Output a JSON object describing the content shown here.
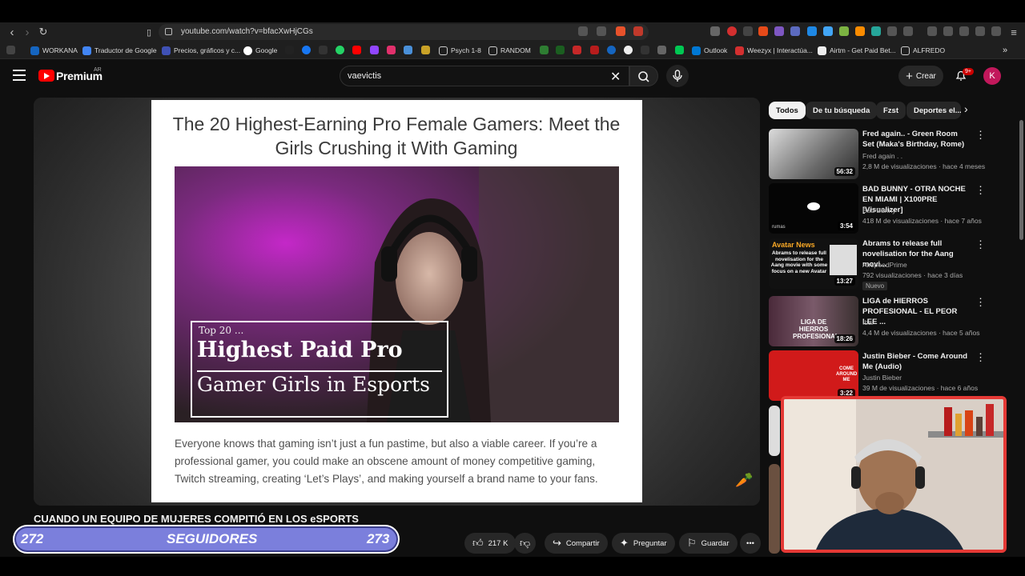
{
  "browser": {
    "url": "youtube.com/watch?v=bfacXwHjCGs",
    "bookmarks": [
      "WORKANA",
      "Traductor de Google",
      "Precios, gráficos y c...",
      "Google",
      "Psych 1-8",
      "RANDOM",
      "Outlook",
      "Weezyx | Interactúa...",
      "Airtm - Get Paid Bet...",
      "ALFREDO"
    ]
  },
  "header": {
    "logo_text": "Premium",
    "logo_region": "AR",
    "search_value": "vaevictis",
    "create_label": "Crear",
    "notification_count": "9+",
    "avatar_letter": "K"
  },
  "video": {
    "article_title": "The 20 Highest-Earning Pro Female Gamers: Meet the Girls Crushing it With Gaming",
    "overlay_top": "Top 20 ...",
    "overlay_main": "Highest Paid Pro",
    "overlay_sub": "Gamer Girls in Esports",
    "article_body": "Everyone knows that gaming isn’t just a fun pastime, but also a viable career. If you’re a professional gamer, you could make an obscene amount of money competitive gaming, Twitch streaming, creating ‘Let’s Plays’, and making yourself a brand name to your fans.",
    "title": "CUANDO UN EQUIPO DE MUJERES COMPITIÓ EN LOS eSPORTS",
    "likes": "217 K",
    "share_label": "Compartir",
    "ask_label": "Preguntar",
    "save_label": "Guardar"
  },
  "follower_overlay": {
    "left": "272",
    "label": "SEGUIDORES",
    "right": "273"
  },
  "chips": [
    "Todos",
    "De tu búsqueda",
    "Fzst",
    "Deportes el..."
  ],
  "recommendations": [
    {
      "title": "Fred again.. - Green Room Set (Maka's Birthday, Rome)",
      "channel": "Fred again . .",
      "meta": "2,8 M de visualizaciones · hace 4 meses",
      "duration": "56:32"
    },
    {
      "title": "BAD BUNNY - OTRA NOCHE EN MIAMI | X100PRE [Visualizer]",
      "channel": "Bad Bunny",
      "meta": "418 M de visualizaciones · hace 7 años",
      "duration": "3:54",
      "thumb_text": "rumas"
    },
    {
      "title": "Abrams to release full novelisation for the Aang movi...",
      "channel": "AirspeedPrime",
      "meta": "792 visualizaciones · hace 3 días",
      "duration": "13:27",
      "badge": "Nuevo",
      "thumb_title": "Avatar News",
      "thumb_text": "Abrams to release full novelisation for the Aang movie with some focus on a new Avatar"
    },
    {
      "title": "LIGA de HIERROS PROFESIONAL - EL PEOR LEE ...",
      "channel": "Ibai",
      "meta": "4,4 M de visualizaciones · hace 5 años",
      "duration": "18:26",
      "thumb_text": "LIGA DE HIERROS PROFESIONAL"
    },
    {
      "title": "Justin Bieber - Come Around Me (Audio)",
      "channel": "Justin Bieber",
      "meta": "39 M de visualizaciones · hace 6 años",
      "duration": "3:22",
      "thumb_text": "COME AROUND ME"
    }
  ]
}
